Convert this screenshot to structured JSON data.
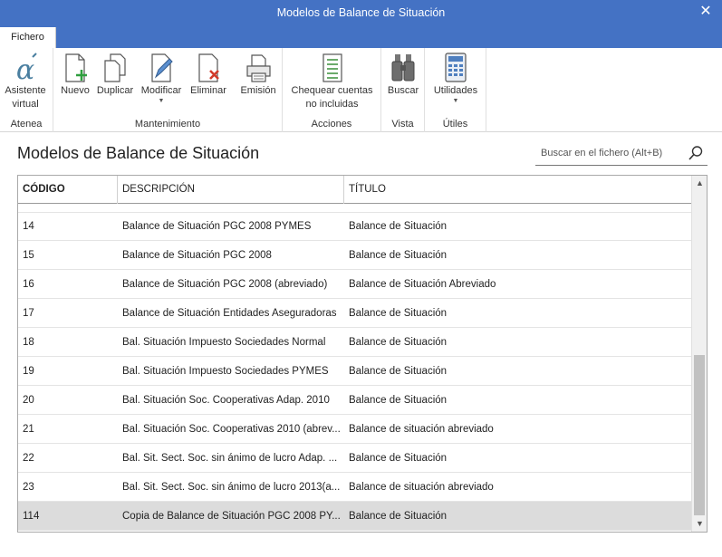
{
  "window": {
    "title": "Modelos de Balance de Situación"
  },
  "tabs": [
    {
      "label": "Fichero"
    }
  ],
  "ribbon": {
    "groups": [
      {
        "label": "Atenea"
      },
      {
        "label": "Mantenimiento"
      },
      {
        "label": "Acciones"
      },
      {
        "label": "Vista"
      },
      {
        "label": "Útiles"
      }
    ],
    "buttons": {
      "asistente": {
        "line1": "Asistente",
        "line2": "virtual",
        "icon": "alpha-icon"
      },
      "nuevo": {
        "label": "Nuevo",
        "icon": "new-document-icon"
      },
      "duplicar": {
        "label": "Duplicar",
        "icon": "duplicate-icon"
      },
      "modificar": {
        "label": "Modificar",
        "icon": "edit-document-icon"
      },
      "eliminar": {
        "label": "Eliminar",
        "icon": "delete-document-icon"
      },
      "emision": {
        "label": "Emisión",
        "icon": "printer-icon"
      },
      "chequear": {
        "line1": "Chequear cuentas",
        "line2": "no incluidas",
        "icon": "check-list-icon"
      },
      "buscar": {
        "label": "Buscar",
        "icon": "binoculars-icon"
      },
      "utilidades": {
        "label": "Utilidades",
        "icon": "calculator-icon"
      }
    }
  },
  "main": {
    "heading": "Modelos de Balance de Situación",
    "search": {
      "placeholder": "Buscar en el fichero (Alt+B)"
    }
  },
  "table": {
    "columns": [
      "CÓDIGO",
      "DESCRIPCIÓN",
      "TÍTULO"
    ],
    "rows": [
      {
        "codigo": "14",
        "descripcion": "Balance de Situación PGC 2008 PYMES",
        "titulo": "Balance de Situación"
      },
      {
        "codigo": "15",
        "descripcion": "Balance de Situación PGC 2008",
        "titulo": "Balance de Situación"
      },
      {
        "codigo": "16",
        "descripcion": "Balance de Situación PGC 2008 (abreviado)",
        "titulo": "Balance de Situación Abreviado"
      },
      {
        "codigo": "17",
        "descripcion": "Balance de Situación Entidades Aseguradoras",
        "titulo": "Balance de Situación"
      },
      {
        "codigo": "18",
        "descripcion": "Bal. Situación  Impuesto Sociedades Normal",
        "titulo": "Balance de Situación"
      },
      {
        "codigo": "19",
        "descripcion": "Bal. Situación  Impuesto Sociedades PYMES",
        "titulo": "Balance de Situación"
      },
      {
        "codigo": "20",
        "descripcion": "Bal. Situación Soc. Cooperativas Adap. 2010",
        "titulo": "Balance de Situación"
      },
      {
        "codigo": "21",
        "descripcion": "Bal. Situación Soc. Cooperativas 2010 (abrev...",
        "titulo": "Balance de situación abreviado"
      },
      {
        "codigo": "22",
        "descripcion": "Bal. Sit. Sect. Soc. sin ánimo de lucro Adap. ...",
        "titulo": "Balance de Situación"
      },
      {
        "codigo": "23",
        "descripcion": "Bal. Sit. Sect. Soc. sin ánimo de lucro 2013(a...",
        "titulo": "Balance de situación abreviado"
      },
      {
        "codigo": "114",
        "descripcion": "Copia de Balance de Situación PGC 2008 PY...",
        "titulo": "Balance de Situación",
        "selected": true
      }
    ]
  },
  "colors": {
    "titlebar": "#4472c4",
    "selected_row": "#dcdcdc"
  }
}
